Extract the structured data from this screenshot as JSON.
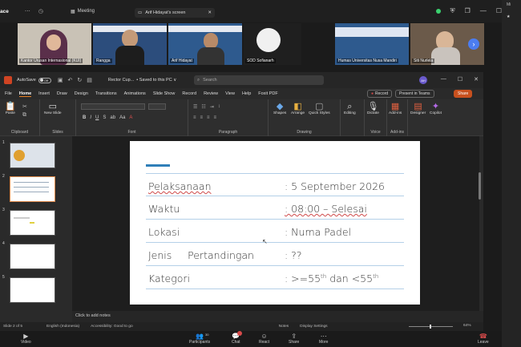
{
  "teams": {
    "app_label": "ace",
    "meeting_label": "Meeting",
    "share_tab_label": "Arif Hidayat's screen",
    "participants": [
      {
        "name": "Kantor Urusan Internasional (KUI)"
      },
      {
        "name": "Rangga"
      },
      {
        "name": "Arif Hidayat"
      },
      {
        "name": "SOD Sofianarh"
      },
      {
        "name": "Humas Universitas Nusa Mandiri"
      },
      {
        "name": "Siti Nurlela"
      }
    ],
    "bottom_bar": {
      "video": "Video",
      "participants": "Participants",
      "participants_count": "30",
      "chat": "Chat",
      "react": "React",
      "share": "Share",
      "more": "More",
      "leave": "Leave"
    },
    "right_strip": {
      "top": "Mi",
      "item": "★"
    }
  },
  "ppt": {
    "autosave": "AutoSave",
    "autosave_state": "Off",
    "doc_name": "Rector Cup...",
    "saved_status": "• Saved to this PC ∨",
    "search_placeholder": "Search",
    "avatar": "AH",
    "menu": [
      "File",
      "Home",
      "Insert",
      "Draw",
      "Design",
      "Transitions",
      "Animations",
      "Slide Show",
      "Record",
      "Review",
      "View",
      "Help",
      "Foxit PDF"
    ],
    "active_menu": "Home",
    "record_btn": "Record",
    "teams_btn": "Present in Teams",
    "share_btn": "Share",
    "ribbon": {
      "clipboard": "Clipboard",
      "paste": "Paste",
      "slides": "Slides",
      "new_slide": "New Slide",
      "font": "Font",
      "paragraph": "Paragraph",
      "drawing": "Drawing",
      "shapes": "Shapes",
      "arrange": "Arrange",
      "quick_styles": "Quick Styles",
      "editing_group": "",
      "editing": "Editing",
      "voice": "Voice",
      "dictate": "Dictate",
      "addins": "Add-ins",
      "addins_btn": "Add-ins",
      "designer": "Designer",
      "copilot": "Copilot",
      "fmt_buttons": [
        "B",
        "I",
        "U",
        "S",
        "ab",
        "Aa",
        "A"
      ]
    },
    "thumbnails": [
      "1",
      "2",
      "3",
      "4",
      "5"
    ],
    "selected_slide": 2,
    "slide": {
      "rows": [
        {
          "label": "Pelaksanaan",
          "value": ": 5 September 2026"
        },
        {
          "label": "Waktu",
          "value": ": 08:00 – Selesai"
        },
        {
          "label": "Lokasi",
          "value": ": Numa Padel"
        },
        {
          "label": "Jenis     Pertandingan",
          "value": ": ??"
        },
        {
          "label": "Kategori",
          "value_prefix": ": >=55",
          "sup1": "th",
          "value_mid": " dan <55",
          "sup2": "th"
        }
      ]
    },
    "notes_placeholder": "Click to add notes",
    "status": {
      "slide_of": "Slide 2 of 5",
      "language": "English (Indonesia)",
      "accessibility": "Accessibility: Good to go",
      "notes": "Notes",
      "display_settings": "Display Settings",
      "zoom": "64%"
    }
  },
  "colors": {
    "accent": "#2f7fb8",
    "share": "#c8501e",
    "leave": "#d74a4a"
  }
}
